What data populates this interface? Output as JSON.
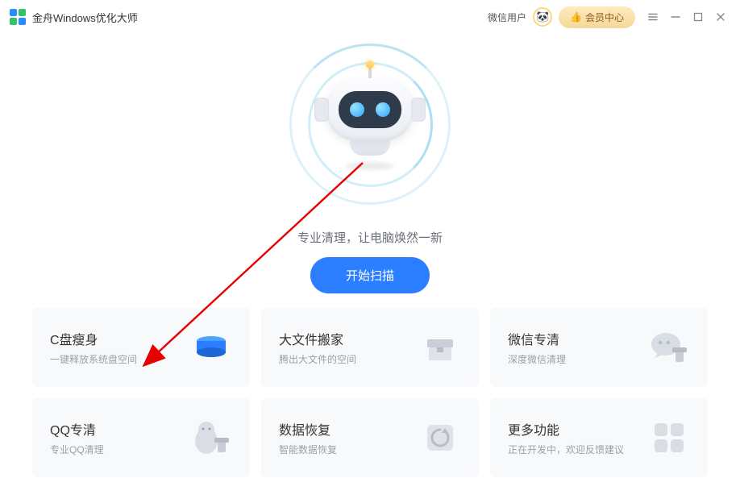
{
  "titlebar": {
    "app_name": "金舟Windows优化大师",
    "user_label": "微信用户",
    "vip_label": "会员中心"
  },
  "hero": {
    "tagline": "专业清理，让电脑焕然一新",
    "scan_button": "开始扫描"
  },
  "cards": [
    {
      "title": "C盘瘦身",
      "sub": "一键释放系统盘空间"
    },
    {
      "title": "大文件搬家",
      "sub": "腾出大文件的空间"
    },
    {
      "title": "微信专清",
      "sub": "深度微信清理"
    },
    {
      "title": "QQ专清",
      "sub": "专业QQ清理"
    },
    {
      "title": "数据恢复",
      "sub": "智能数据恢复"
    },
    {
      "title": "更多功能",
      "sub": "正在开发中，欢迎反馈建议"
    }
  ],
  "colors": {
    "accent": "#2a7eff",
    "logo_blue": "#2a8cff",
    "logo_green": "#33c36b"
  }
}
